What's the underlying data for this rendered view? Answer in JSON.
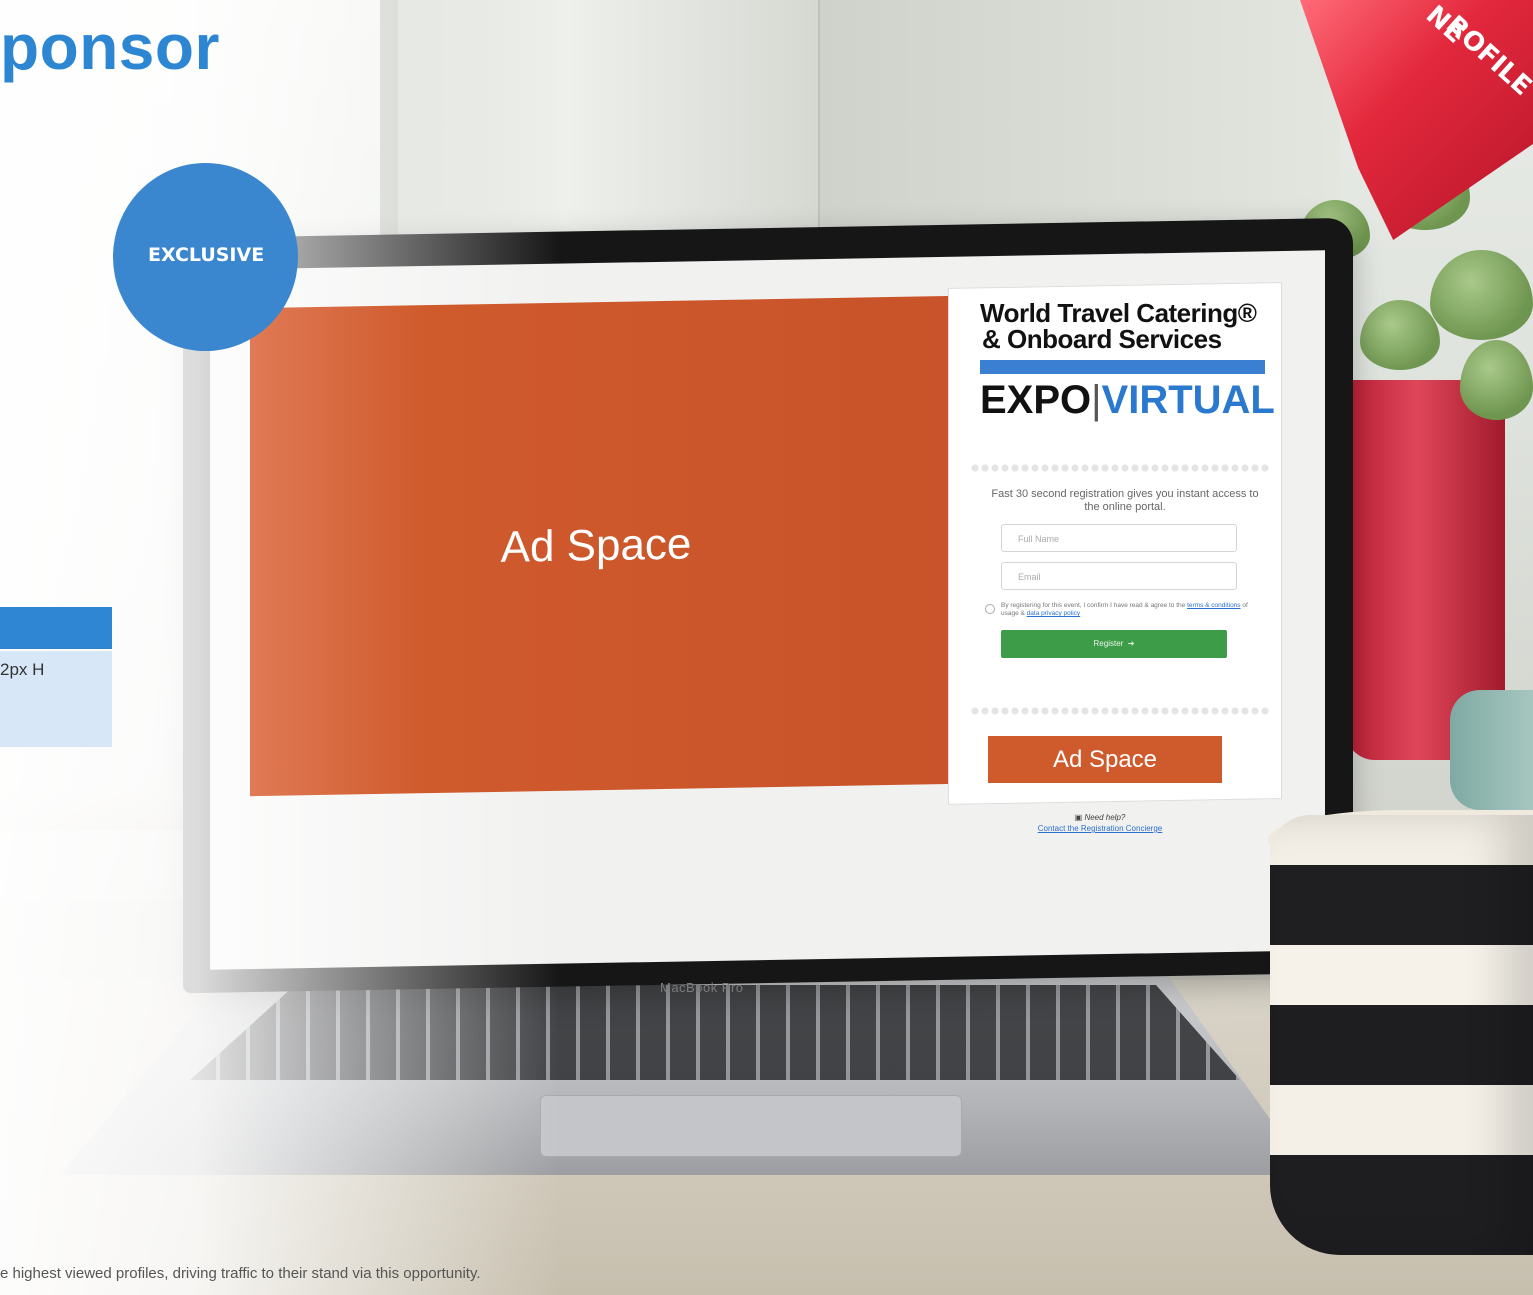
{
  "brochure": {
    "heading": "ponsor",
    "exclusive_badge": "EXCLUSIVE",
    "spec_text": "2px H",
    "footnote": "e highest viewed profiles, driving traffic to their stand via this opportunity.",
    "ribbon_line1": "NE",
    "ribbon_line2": "ROFILE",
    "accent_color": "#2d86d1",
    "ribbon_color": "#e3283c"
  },
  "laptop": {
    "brand_label": "MacBook Pro"
  },
  "screen": {
    "main_ad": {
      "label": "Ad Space",
      "color": "#cf5a2c"
    },
    "logo": {
      "line1": "World Travel Catering®",
      "line2": "& Onboard Services",
      "expo": "EXPO",
      "separator": "|",
      "virtual": "VIRTUAL"
    },
    "registration": {
      "intro": "Fast 30 second registration gives you instant access to the online portal.",
      "full_name_placeholder": "Full Name",
      "email_placeholder": "Email",
      "consent_prefix": "By registering for this event, I confirm I have read & agree to the",
      "terms_link": "terms & conditions",
      "consent_mid": "of usage &",
      "privacy_link": "data privacy policy",
      "register_label": "Register",
      "register_color": "#3c9c48"
    },
    "side_ad": {
      "label": "Ad Space"
    },
    "help": {
      "icon": "chat-icon",
      "label": "Need help?",
      "link": "Contact the Registration Concierge"
    }
  }
}
